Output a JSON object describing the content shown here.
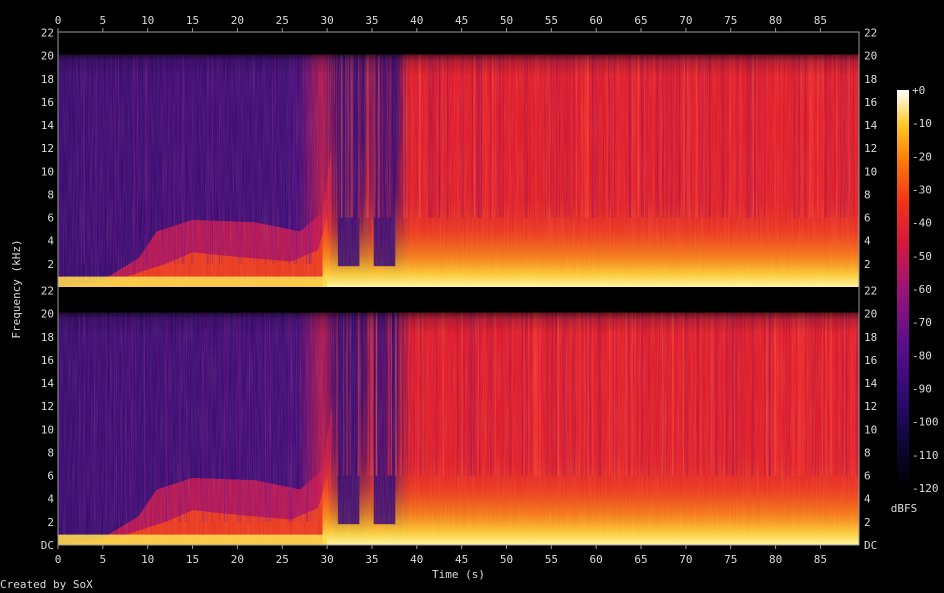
{
  "chart_data": {
    "type": "heatmap",
    "title": "",
    "xlabel": "Time (s)",
    "ylabel": "Frequency (kHz)",
    "x_ticks": [
      0,
      5,
      10,
      15,
      20,
      25,
      30,
      35,
      40,
      45,
      50,
      55,
      60,
      65,
      70,
      75,
      80,
      85
    ],
    "xlim": [
      0,
      89.3
    ],
    "y_ticks": [
      "DC",
      "2",
      "4",
      "6",
      "8",
      "10",
      "12",
      "14",
      "16",
      "18",
      "20",
      "22"
    ],
    "ylim_khz": [
      0,
      22.05
    ],
    "channels": 2,
    "colorbar": {
      "label": "dBFS",
      "ticks": [
        "+0",
        "-10",
        "-20",
        "-30",
        "-40",
        "-50",
        "-60",
        "-70",
        "-80",
        "-90",
        "-100",
        "-110",
        "-120"
      ],
      "range": [
        -120,
        0
      ]
    },
    "colors": {
      "background": "#000000",
      "axis": "#dcdcdc",
      "quiet": "#3a0a6a",
      "mid": "#e01828",
      "loud": "#fff48a"
    },
    "segments": [
      {
        "t0": 0,
        "t1": 30,
        "character": "fade-in, low energy above 6 kHz"
      },
      {
        "t0": 30,
        "t1": 38,
        "character": "dropouts near 31-33 s and 35-37 s"
      },
      {
        "t0": 38,
        "t1": 89.3,
        "character": "dense broadband content to 20 kHz"
      }
    ]
  },
  "footer": {
    "credit": "Created by SoX"
  }
}
